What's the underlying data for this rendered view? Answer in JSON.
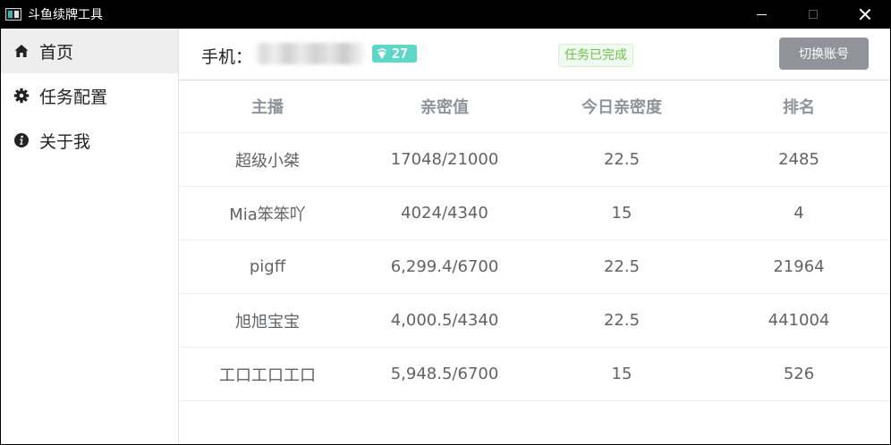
{
  "window": {
    "title": "斗鱼续牌工具"
  },
  "sidebar": {
    "items": [
      {
        "label": "首页",
        "icon": "home-icon",
        "active": true
      },
      {
        "label": "任务配置",
        "icon": "gear-icon",
        "active": false
      },
      {
        "label": "关于我",
        "icon": "info-icon",
        "active": false
      }
    ]
  },
  "header": {
    "phone_label": "手机：",
    "level": "27",
    "status": "任务已完成",
    "switch_label": "切换账号"
  },
  "table": {
    "columns": [
      "主播",
      "亲密值",
      "今日亲密度",
      "排名"
    ],
    "rows": [
      [
        "超级小桀",
        "17048/21000",
        "22.5",
        "2485"
      ],
      [
        "Mia笨笨吖",
        "4024/4340",
        "15",
        "4"
      ],
      [
        "pigff",
        "6,299.4/6700",
        "22.5",
        "21964"
      ],
      [
        "旭旭宝宝",
        "4,000.5/4340",
        "22.5",
        "441004"
      ],
      [
        "工口工口工口",
        "5,948.5/6700",
        "15",
        "526"
      ]
    ]
  },
  "colors": {
    "level_badge": "#5fd7c8",
    "status_text": "#6bc24a",
    "switch_button": "#909399",
    "active_nav": "#eeeeee"
  }
}
